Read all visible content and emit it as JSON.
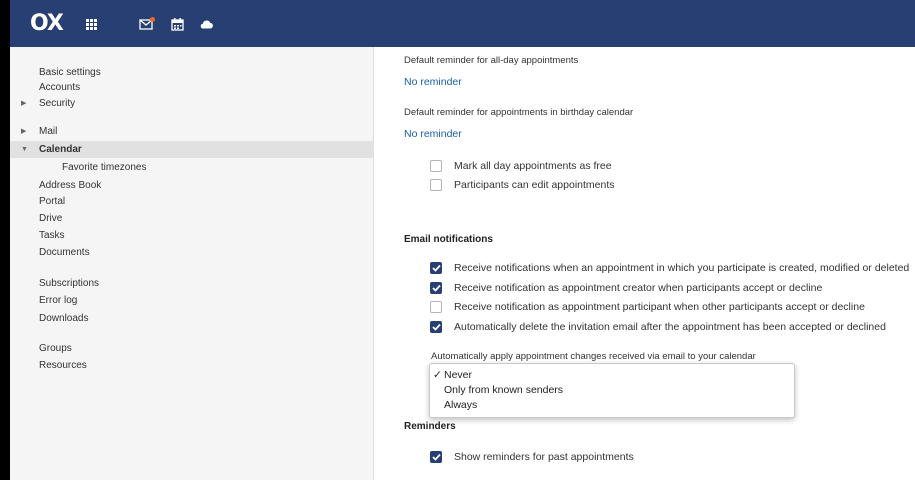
{
  "topbar": {
    "logo": "OX"
  },
  "sidebar": {
    "items": [
      {
        "label": "Basic settings"
      },
      {
        "label": "Accounts"
      },
      {
        "label": "Security"
      },
      {
        "label": "Mail"
      },
      {
        "label": "Calendar"
      },
      {
        "label": "Favorite timezones"
      },
      {
        "label": "Address Book"
      },
      {
        "label": "Portal"
      },
      {
        "label": "Drive"
      },
      {
        "label": "Tasks"
      },
      {
        "label": "Documents"
      },
      {
        "label": "Subscriptions"
      },
      {
        "label": "Error log"
      },
      {
        "label": "Downloads"
      },
      {
        "label": "Groups"
      },
      {
        "label": "Resources"
      }
    ]
  },
  "main": {
    "allday_reminder_label": "Default reminder for all-day appointments",
    "allday_reminder_value": "No reminder",
    "birthday_reminder_label": "Default reminder for appointments in birthday calendar",
    "birthday_reminder_value": "No reminder",
    "options": [
      {
        "label": "Mark all day appointments as free",
        "checked": false
      },
      {
        "label": "Participants can edit appointments",
        "checked": false
      }
    ],
    "email_heading": "Email notifications",
    "email_options": [
      {
        "label": "Receive notifications when an appointment in which you participate is created, modified or deleted",
        "checked": true
      },
      {
        "label": "Receive notification as appointment creator when participants accept or decline",
        "checked": true
      },
      {
        "label": "Receive notification as appointment participant when other participants accept or decline",
        "checked": false
      },
      {
        "label": "Automatically delete the invitation email after the appointment has been accepted or declined",
        "checked": true
      }
    ],
    "auto_apply_label": "Automatically apply appointment changes received via email to your calendar",
    "auto_apply_options": [
      "Never",
      "Only from known senders",
      "Always"
    ],
    "auto_apply_selected": "Never",
    "check_mark": "✓",
    "reminders_heading": "Reminders",
    "reminder_options": [
      {
        "label": "Show reminders for past appointments",
        "checked": true
      }
    ]
  },
  "colors": {
    "topbar": "#283f73",
    "link": "#1b5ea8",
    "mail_badge": "#f26522"
  }
}
